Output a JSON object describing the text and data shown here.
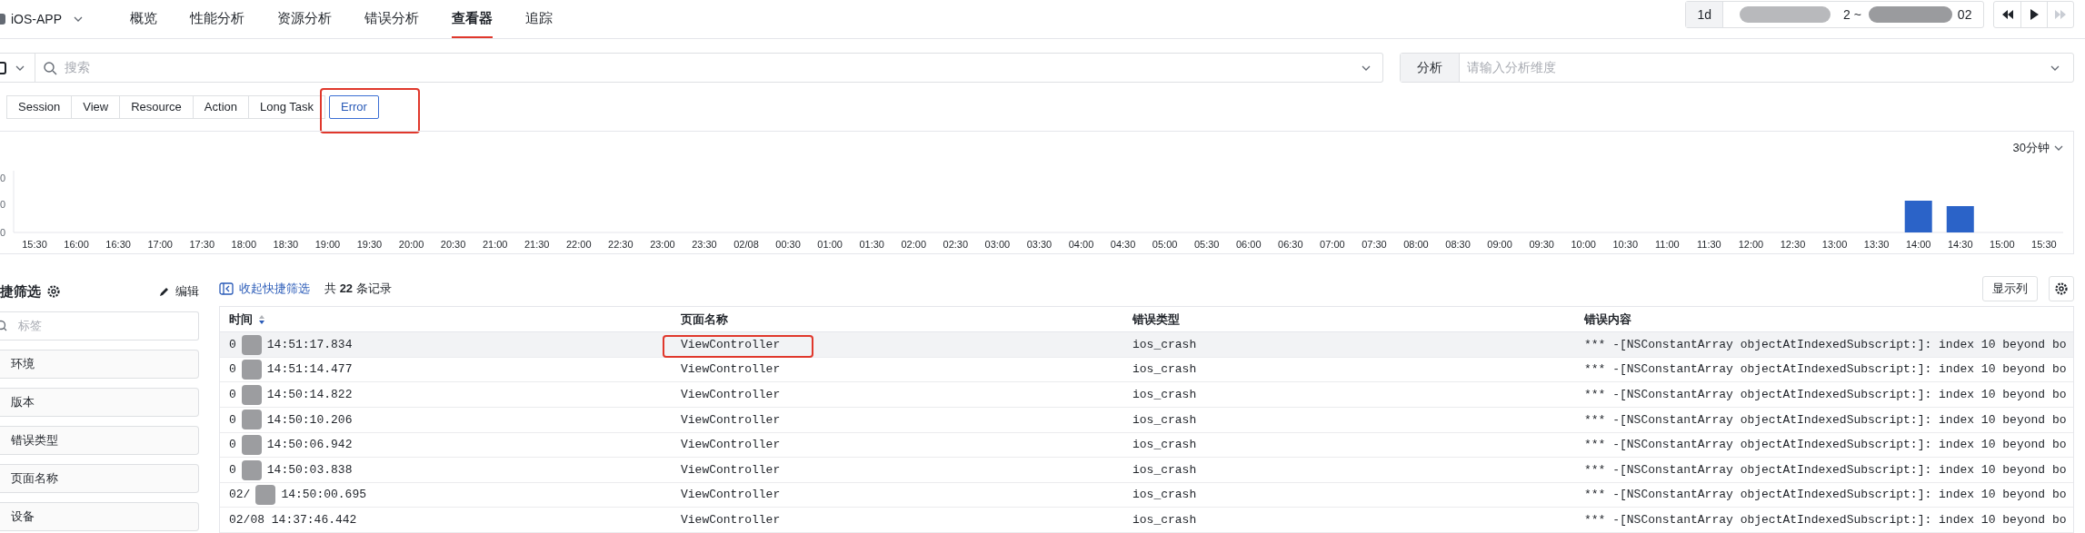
{
  "app": {
    "name": "iOS-APP"
  },
  "nav": [
    {
      "label": "概览",
      "selected": false
    },
    {
      "label": "性能分析",
      "selected": false
    },
    {
      "label": "资源分析",
      "selected": false
    },
    {
      "label": "错误分析",
      "selected": false
    },
    {
      "label": "查看器",
      "selected": true
    },
    {
      "label": "追踪",
      "selected": false
    }
  ],
  "time_range": {
    "preset": "1d",
    "visible_text": [
      "2 ~",
      "02"
    ]
  },
  "playback": [
    {
      "kind": "rewind",
      "disabled": false
    },
    {
      "kind": "play",
      "disabled": false
    },
    {
      "kind": "forward",
      "disabled": true
    }
  ],
  "search": {
    "placeholder": "搜索"
  },
  "analysis": {
    "label": "分析",
    "placeholder": "请输入分析维度"
  },
  "tabs": [
    {
      "label": "Session",
      "selected": false,
      "annotated": false
    },
    {
      "label": "View",
      "selected": false,
      "annotated": false
    },
    {
      "label": "Resource",
      "selected": false,
      "annotated": false
    },
    {
      "label": "Action",
      "selected": false,
      "annotated": false
    },
    {
      "label": "Long Task",
      "selected": false,
      "annotated": false
    },
    {
      "label": "Error",
      "selected": true,
      "annotated": true
    }
  ],
  "chart": {
    "interval": "30分钟",
    "y_labels": [
      "0",
      "0",
      "0"
    ],
    "x_labels": [
      "15:30",
      "16:00",
      "16:30",
      "17:00",
      "17:30",
      "18:00",
      "18:30",
      "19:00",
      "19:30",
      "20:00",
      "20:30",
      "21:00",
      "21:30",
      "22:00",
      "22:30",
      "23:00",
      "23:30",
      "02/08",
      "00:30",
      "01:00",
      "01:30",
      "02:00",
      "02:30",
      "03:00",
      "03:30",
      "04:00",
      "04:30",
      "05:00",
      "05:30",
      "06:00",
      "06:30",
      "07:00",
      "07:30",
      "08:00",
      "08:30",
      "09:00",
      "09:30",
      "10:00",
      "10:30",
      "11:00",
      "11:30",
      "12:00",
      "12:30",
      "13:00",
      "13:30",
      "14:00",
      "14:30",
      "15:00",
      "15:30"
    ]
  },
  "quick_filter": {
    "title": "捷筛选",
    "edit": "编辑",
    "search_placeholder": "标签",
    "items": [
      "环境",
      "版本",
      "错误类型",
      "页面名称",
      "设备"
    ]
  },
  "records": {
    "collapse": "收起快捷筛选",
    "count": "共 **22** 条记录",
    "columns_button": "显示列"
  },
  "table": {
    "columns": [
      "时间",
      "页面名称",
      "错误类型",
      "错误内容"
    ],
    "rows": [
      {
        "time_start": "0",
        "time_end": "14:51:17.834",
        "page": "ViewController",
        "page_annotated": true,
        "error_type": "ios_crash",
        "content": "*** -[NSConstantArray objectAtIndexedSubscript:]: index 10 beyond bo",
        "selected": true
      },
      {
        "time_start": "0",
        "time_end": "14:51:14.477",
        "page": "ViewController",
        "page_annotated": false,
        "error_type": "ios_crash",
        "content": "*** -[NSConstantArray objectAtIndexedSubscript:]: index 10 beyond bo",
        "selected": false
      },
      {
        "time_start": "0",
        "time_end": "14:50:14.822",
        "page": "ViewController",
        "page_annotated": false,
        "error_type": "ios_crash",
        "content": "*** -[NSConstantArray objectAtIndexedSubscript:]: index 10 beyond bo",
        "selected": false
      },
      {
        "time_start": "0",
        "time_end": "14:50:10.206",
        "page": "ViewController",
        "page_annotated": false,
        "error_type": "ios_crash",
        "content": "*** -[NSConstantArray objectAtIndexedSubscript:]: index 10 beyond bo",
        "selected": false
      },
      {
        "time_start": "0",
        "time_end": "14:50:06.942",
        "page": "ViewController",
        "page_annotated": false,
        "error_type": "ios_crash",
        "content": "*** -[NSConstantArray objectAtIndexedSubscript:]: index 10 beyond bo",
        "selected": false
      },
      {
        "time_start": "0",
        "time_end": "14:50:03.838",
        "page": "ViewController",
        "page_annotated": false,
        "error_type": "ios_crash",
        "content": "*** -[NSConstantArray objectAtIndexedSubscript:]: index 10 beyond bo",
        "selected": false
      },
      {
        "time_start": "02/",
        "time_end": "14:50:00.695",
        "page": "ViewController",
        "page_annotated": false,
        "error_type": "ios_crash",
        "content": "*** -[NSConstantArray objectAtIndexedSubscript:]: index 10 beyond bo",
        "selected": false
      },
      {
        "time": "02/08 14:37:46.442",
        "page": "ViewController",
        "page_annotated": false,
        "error_type": "ios_crash",
        "content": "*** -[NSConstantArray objectAtIndexedSubscript:]: index 10 beyond bo",
        "selected": false
      }
    ]
  }
}
